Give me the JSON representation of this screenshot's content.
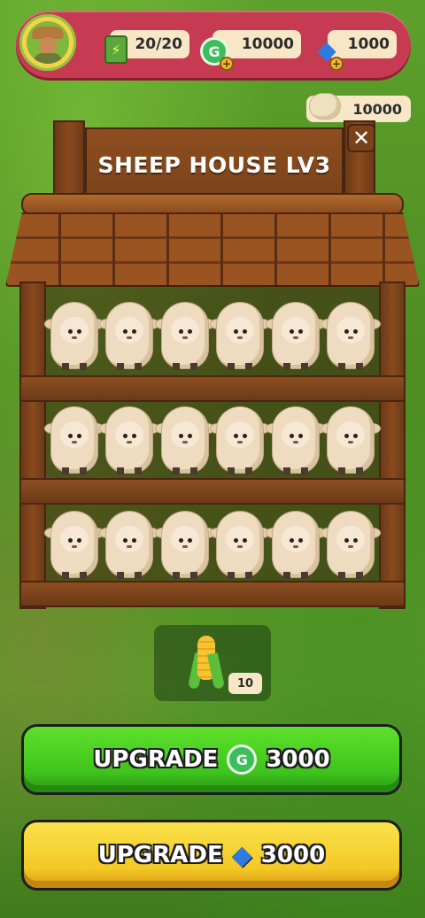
{
  "hud": {
    "energy": "20/20",
    "coins": "10000",
    "gems": "1000",
    "wool": "10000",
    "icons": {
      "avatar": "farmer-avatar",
      "energy": "energy-bottle-icon",
      "coin": "green-coin-icon",
      "gem": "blue-gem-icon",
      "plus": "plus-icon",
      "wool": "wool-icon"
    },
    "coin_glyph": "G",
    "gem_glyph": "◆",
    "plus_glyph": "+",
    "energy_glyph": "⚡"
  },
  "building": {
    "title": "SHEEP HOUSE LV3",
    "close_glyph": "✕",
    "sheep_rows": [
      6,
      6,
      6
    ]
  },
  "feed": {
    "icon": "corn-icon",
    "count": "10"
  },
  "buttons": {
    "upgrade_coins": {
      "label": "UPGRADE",
      "cost": "3000",
      "icon": "green-coin-icon",
      "color": "#3fc41d"
    },
    "upgrade_gems": {
      "label": "UPGRADE",
      "cost": "3000",
      "icon": "blue-gem-icon",
      "color": "#f3c926"
    }
  }
}
